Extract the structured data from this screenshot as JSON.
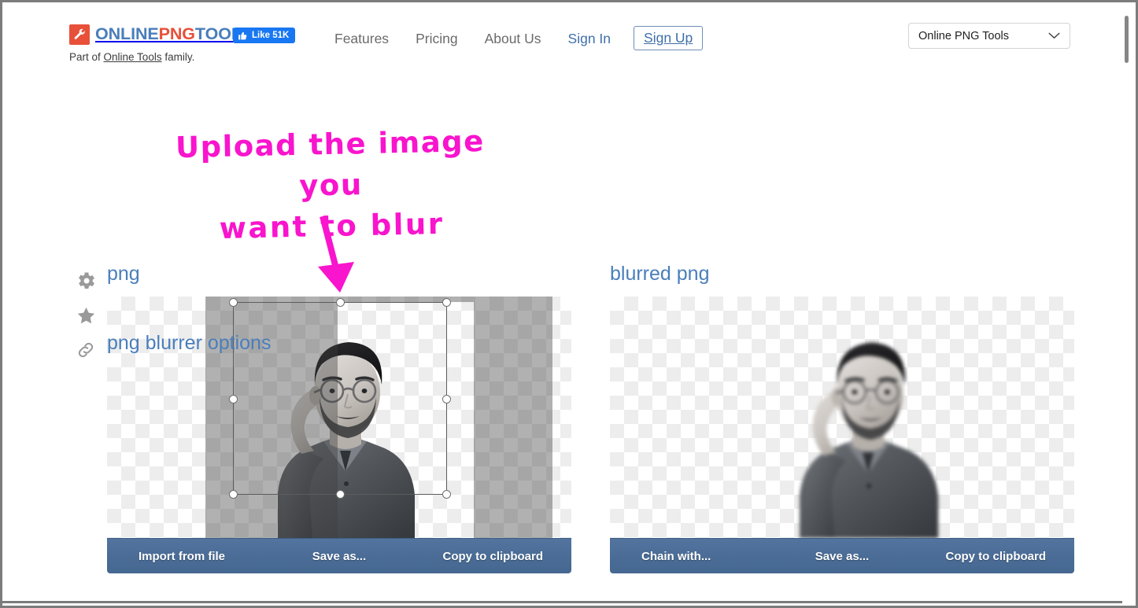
{
  "header": {
    "logo_icon": "wrench-icon",
    "brand": {
      "part1": "ONLINE",
      "part2": "PNG",
      "part3": "TOOLS"
    },
    "facebook_like": {
      "icon": "thumbs-up-icon",
      "label": "Like 51K"
    },
    "tagline_prefix": "Part of ",
    "tagline_link": "Online Tools",
    "tagline_suffix": " family.",
    "nav": [
      {
        "label": "Features",
        "accent": false
      },
      {
        "label": "Pricing",
        "accent": false
      },
      {
        "label": "About Us",
        "accent": false
      },
      {
        "label": "Sign In",
        "accent": true
      }
    ],
    "signup_label": "Sign Up",
    "site_switcher": {
      "selected": "Online PNG Tools",
      "chevron_icon": "chevron-down-icon"
    }
  },
  "annotation": {
    "line1": "Upload the image you",
    "line2": "want to blur",
    "color": "#f914cd",
    "arrow_icon": "down-arrow-annotation"
  },
  "tool": {
    "sidebar": [
      {
        "name": "gear-icon",
        "label": "Tool options"
      },
      {
        "name": "star-icon",
        "label": "Add to favorites"
      },
      {
        "name": "link-icon",
        "label": "Copy link"
      }
    ],
    "input_panel": {
      "title": "png",
      "actions": [
        "Import from file",
        "Save as...",
        "Copy to clipboard"
      ]
    },
    "output_panel": {
      "title": "blurred png",
      "actions": [
        "Chain with...",
        "Save as...",
        "Copy to clipboard"
      ]
    },
    "options_heading": "png blurrer options"
  },
  "colors": {
    "brand_blue": "#4a7ebb",
    "brand_red": "#e8503a",
    "toolbar_blue": "#4a6c96",
    "annotation_pink": "#f914cd",
    "facebook_blue": "#1877f2"
  }
}
